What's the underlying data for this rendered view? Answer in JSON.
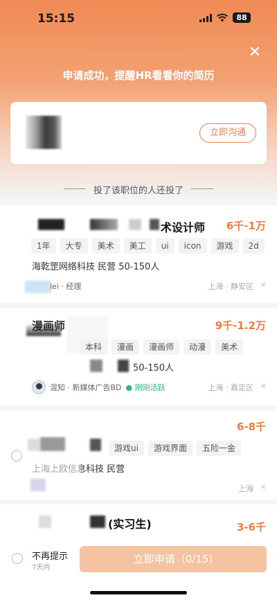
{
  "status_bar": {
    "time": "15:15",
    "battery": "88"
  },
  "header": {
    "title": "申请成功，提醒HR看看你的简历"
  },
  "hr_card": {
    "chat_button": "立即沟通"
  },
  "section": {
    "title": "投了该职位的人还投了"
  },
  "jobs": [
    {
      "title": "术设计师",
      "salary": "6千-1万",
      "tags": [
        "1年",
        "大专",
        "美术",
        "美工",
        "ui",
        "icon",
        "游戏",
        "2d"
      ],
      "company": "海乾罡网络科技  民营  50-150人",
      "recruiter": "lei · 经理",
      "location": "上海 · 静安区",
      "dismiss": "×"
    },
    {
      "title": "漫画师",
      "salary": "9千-1.2万",
      "tags": [
        "本科",
        "漫画",
        "漫画师",
        "动漫",
        "美术"
      ],
      "company": "50-150人",
      "recruiter": "混知 · 新媒体广告BD",
      "active": "● 刚刚活跃",
      "location": "上海 · 嘉定区",
      "dismiss": "×"
    },
    {
      "title": "",
      "salary": "6-8千",
      "tags": [
        "游戏ui",
        "游戏界面",
        "五险一金"
      ],
      "company": "上海上欧信息科技  民营",
      "location": "上海",
      "dismiss": "×"
    },
    {
      "title": "(实习生)",
      "salary": "3-6千"
    }
  ],
  "bottom": {
    "no_remind": "不再提示",
    "seven_days": "7天内",
    "apply_button": "立即申请（0/15)"
  }
}
